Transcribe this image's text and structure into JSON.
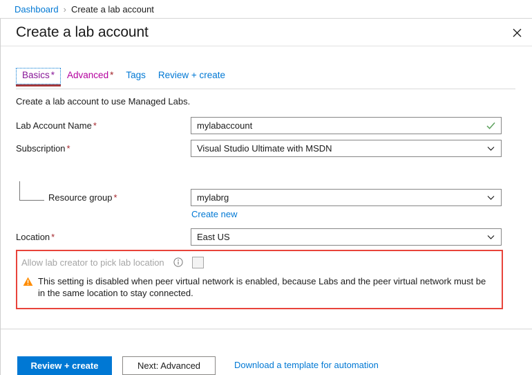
{
  "breadcrumb": {
    "root": "Dashboard",
    "separator": "›",
    "current": "Create a lab account"
  },
  "blade": {
    "title": "Create a lab account",
    "close_icon": "close-icon"
  },
  "tabs": [
    {
      "label": "Basics",
      "required": "*",
      "selected": true
    },
    {
      "label": "Advanced",
      "required": "*",
      "selected": false
    },
    {
      "label": "Tags",
      "required": "",
      "selected": false
    },
    {
      "label": "Review + create",
      "required": "",
      "selected": false
    }
  ],
  "intro": "Create a lab account to use Managed Labs.",
  "fields": {
    "lab_account_name": {
      "label": "Lab Account Name",
      "required": "*",
      "value": "mylabaccount",
      "validation_icon": "check-icon"
    },
    "subscription": {
      "label": "Subscription",
      "required": "*",
      "value": "Visual Studio Ultimate with MSDN",
      "chevron_icon": "chevron-down-icon"
    },
    "resource_group": {
      "label": "Resource group",
      "required": "*",
      "value": "mylabrg",
      "chevron_icon": "chevron-down-icon",
      "create_new_link": "Create new"
    },
    "location": {
      "label": "Location",
      "required": "*",
      "value": "East US",
      "chevron_icon": "chevron-down-icon"
    },
    "allow_lab_creator": {
      "label": "Allow lab creator to pick lab location",
      "info_icon": "info-icon",
      "checked": false,
      "disabled": true
    }
  },
  "warning": {
    "icon": "warning-triangle-icon",
    "text": "This setting is disabled when peer virtual network is enabled, because Labs and the peer virtual network must be in the same location to stay connected."
  },
  "footer": {
    "primary_button": "Review + create",
    "secondary_button": "Next: Advanced",
    "template_link": "Download a template for automation"
  },
  "colors": {
    "accent_blue": "#0078d4",
    "required_red": "#a4262c",
    "selected_tab_purple": "#881798",
    "tab_underline": "#a4373a",
    "warning_border": "#e8433a",
    "warning_orange": "#ff8c00",
    "success_green": "#5ca05c"
  }
}
